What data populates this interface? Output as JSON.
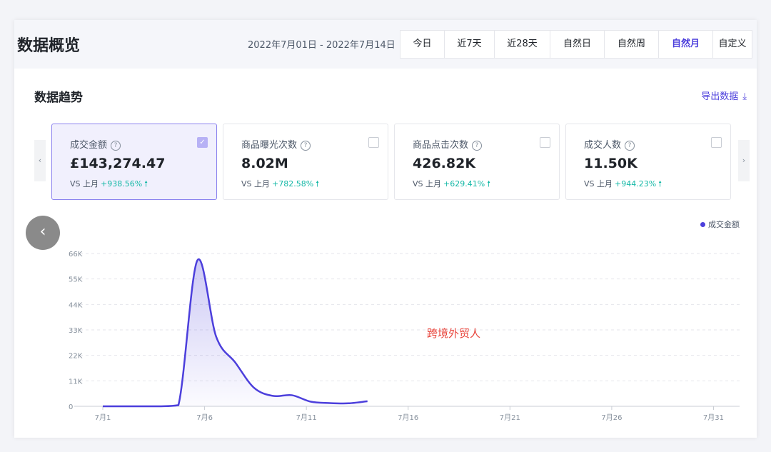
{
  "header": {
    "title": "数据概览",
    "date_range": "2022年7月01日 - 2022年7月14日",
    "tabs": [
      {
        "label": "今日",
        "active": false
      },
      {
        "label": "近7天",
        "active": false
      },
      {
        "label": "近28天",
        "active": false
      },
      {
        "label": "自然日",
        "active": false
      },
      {
        "label": "自然周",
        "active": false
      },
      {
        "label": "自然月",
        "active": true
      },
      {
        "label": "自定义",
        "active": false
      }
    ]
  },
  "trend": {
    "title": "数据趋势",
    "export_label": "导出数据",
    "export_icon": "download-icon"
  },
  "metrics": [
    {
      "label": "成交金额",
      "value": "£143,274.47",
      "compare_label": "VS 上月",
      "change": "+938.56%",
      "selected": true
    },
    {
      "label": "商品曝光次数",
      "value": "8.02M",
      "compare_label": "VS 上月",
      "change": "+782.58%",
      "selected": false
    },
    {
      "label": "商品点击次数",
      "value": "426.82K",
      "compare_label": "VS 上月",
      "change": "+629.41%",
      "selected": false
    },
    {
      "label": "成交人数",
      "value": "11.50K",
      "compare_label": "VS 上月",
      "change": "+944.23%",
      "selected": false
    }
  ],
  "watermark": "跨境外贸人",
  "colors": {
    "accent": "#4c3fdc",
    "positive": "#14b8a6"
  },
  "chart_data": {
    "type": "area",
    "series": [
      {
        "name": "成交金额",
        "values": [
          0,
          0,
          0,
          0,
          500,
          63000,
          30000,
          19000,
          8000,
          4500,
          4800,
          2000,
          1400,
          1300,
          2200
        ]
      }
    ],
    "x": [
      "7月1",
      "7月2",
      "7月3",
      "7月4",
      "7月5",
      "7月6",
      "7月7",
      "7月8",
      "7月9",
      "7月10",
      "7月11",
      "7月12",
      "7月13",
      "7月14"
    ],
    "x_ticks": [
      "7月1",
      "7月6",
      "7月11",
      "7月16",
      "7月21",
      "7月26",
      "7月31"
    ],
    "x_tick_days": [
      1,
      6,
      11,
      16,
      21,
      26,
      31
    ],
    "y_ticks": [
      "0",
      "11K",
      "22K",
      "33K",
      "44K",
      "55K",
      "66K"
    ],
    "ylim": [
      0,
      66000
    ],
    "legend": "top-right",
    "grid": true
  }
}
